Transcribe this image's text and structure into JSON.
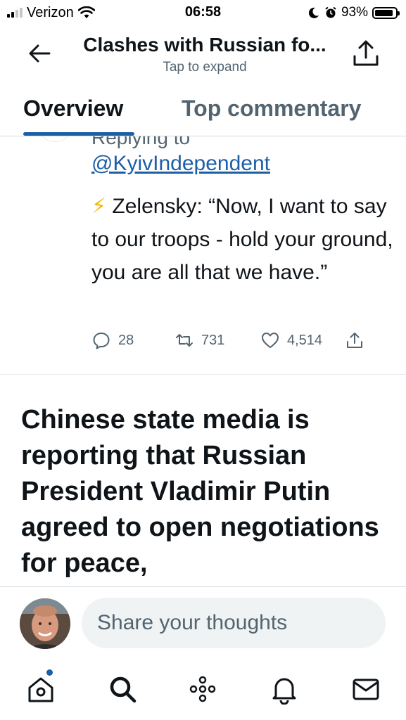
{
  "status_bar": {
    "carrier": "Verizon",
    "time": "06:58",
    "battery": "93%",
    "battery_level": 0.93
  },
  "header": {
    "title": "Clashes with Russian fo...",
    "subtitle": "Tap to expand"
  },
  "tabs": [
    {
      "label": "Overview",
      "active": true
    },
    {
      "label": "Top commentary",
      "active": false
    }
  ],
  "tweet": {
    "replying_cut": "Replying to",
    "mention": "@KyivIndependent",
    "bolt": "⚡",
    "text": "Zelensky: “Now, I want to say to our troops - hold your ground, you are all that we have.”",
    "replies": "28",
    "retweets": "731",
    "likes": "4,514"
  },
  "headline": "Chinese state media is reporting that Russian President Vladimir Putin agreed to open negotiations for peace,",
  "composer": {
    "placeholder": "Share your thoughts"
  },
  "bottom_nav": [
    {
      "icon": "home-icon",
      "notification": true
    },
    {
      "icon": "search-icon"
    },
    {
      "icon": "spaces-icon"
    },
    {
      "icon": "bell-icon"
    },
    {
      "icon": "mail-icon"
    }
  ],
  "colors": {
    "accent": "#1d5fa6",
    "text": "#0f1419",
    "secondary": "#536471"
  }
}
